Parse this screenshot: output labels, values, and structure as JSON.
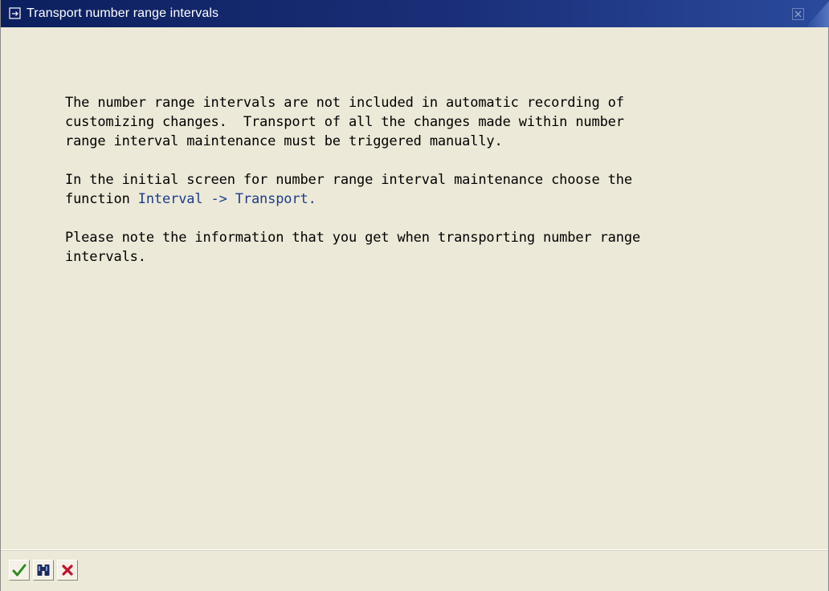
{
  "window": {
    "title": "Transport number range intervals",
    "title_icon": "dialog-icon",
    "close_icon": "close-icon"
  },
  "message": {
    "paragraph1": "The number range intervals are not included in automatic recording of\ncustomizing changes.  Transport of all the changes made within number\nrange interval maintenance must be triggered manually.",
    "paragraph2_prefix": "In the initial screen for number range interval maintenance choose the\nfunction ",
    "link_interval": "Interval",
    "arrow": " -> ",
    "link_transport": "Transport",
    "paragraph2_suffix": ".",
    "paragraph3": "Please note the information that you get when transporting number range\nintervals."
  },
  "footer": {
    "buttons": [
      {
        "icon": "checkmark-icon"
      },
      {
        "icon": "binoculars-icon"
      },
      {
        "icon": "cancel-x-icon"
      }
    ]
  },
  "colors": {
    "titlebar": "#0c1f5e",
    "background": "#ece9d8",
    "link": "#1b3c8a",
    "check_green": "#2e8b1e",
    "cancel_red": "#c8102e"
  }
}
